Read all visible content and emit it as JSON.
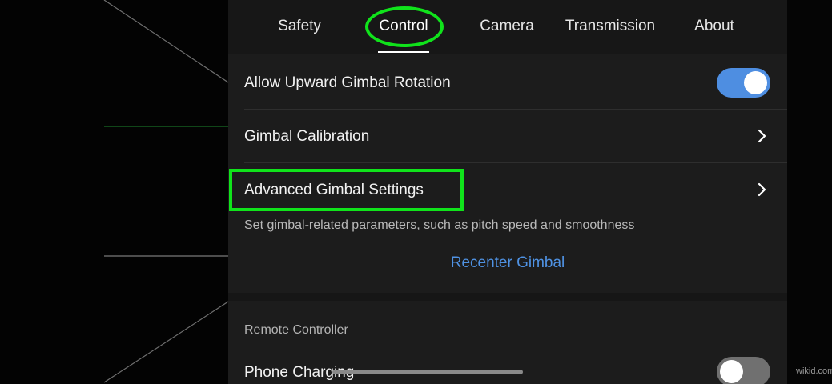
{
  "tabs": [
    {
      "label": "Safety"
    },
    {
      "label": "Control"
    },
    {
      "label": "Camera"
    },
    {
      "label": "Transmission"
    },
    {
      "label": "About"
    }
  ],
  "active_tab": "Control",
  "settings": {
    "upward_rotation": {
      "label": "Allow Upward Gimbal Rotation",
      "enabled": true
    },
    "calibration": {
      "label": "Gimbal Calibration"
    },
    "advanced": {
      "label": "Advanced Gimbal Settings",
      "description": "Set gimbal-related parameters, such as pitch speed and smoothness"
    },
    "recenter": {
      "label": "Recenter Gimbal"
    }
  },
  "remote_controller": {
    "section_title": "Remote Controller",
    "phone_charging": {
      "label": "Phone Charging",
      "enabled": false
    }
  },
  "watermark": "wikid.com",
  "colors": {
    "accent": "#4e8ee1",
    "highlight": "#10e31b",
    "panel_bg": "#1c1c1c"
  }
}
